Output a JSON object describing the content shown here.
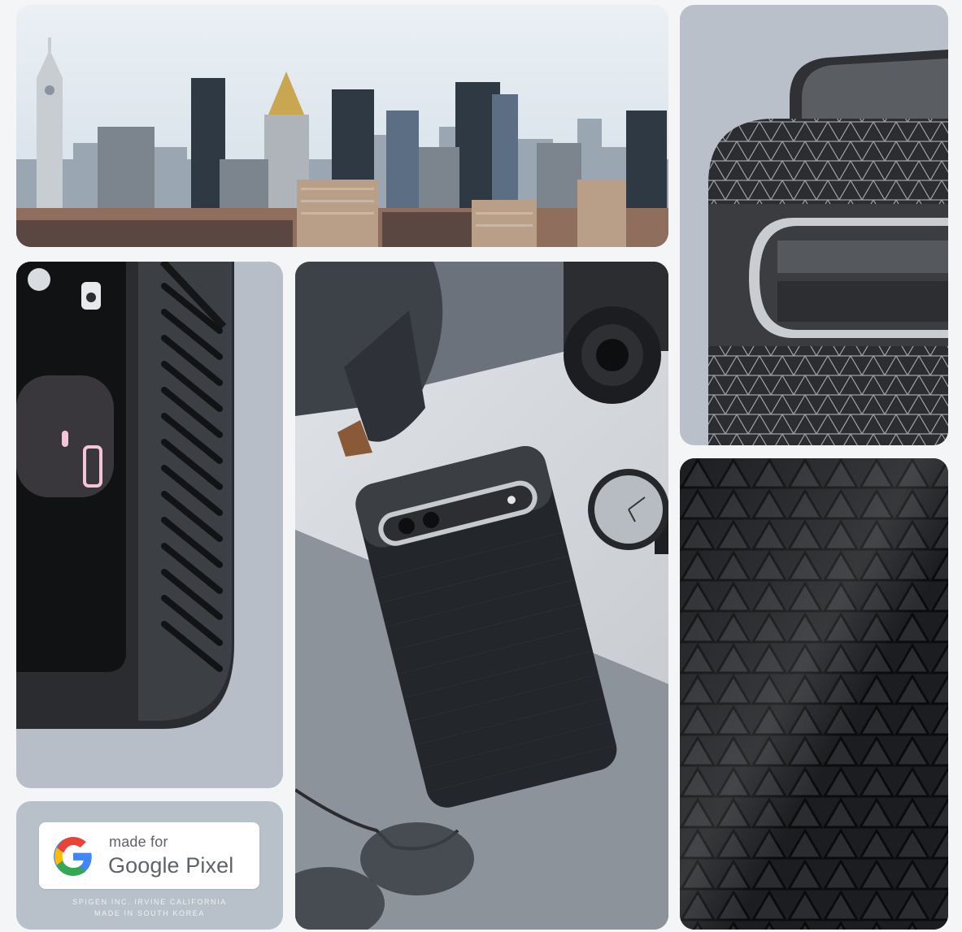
{
  "badge": {
    "made_for": "made for",
    "brand": "Google Pixel",
    "logo": "google-g-logo",
    "line1": "SPIGEN INC. IRVINE CALIFORNIA",
    "line2": "MADE IN SOUTH KOREA"
  },
  "colors": {
    "case_black": "#1f2226",
    "case_gray": "#3a3d42",
    "backdrop_blue_gray": "#b9c0c9",
    "sky": "#d8e4ee",
    "google_blue": "#4285F4",
    "google_red": "#EA4335",
    "google_yellow": "#FBBC05",
    "google_green": "#34A853"
  }
}
